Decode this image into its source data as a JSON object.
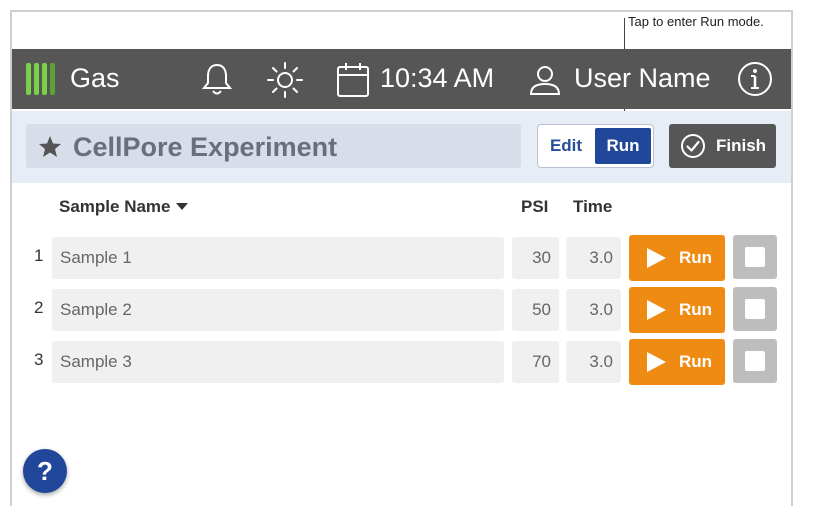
{
  "annotation": {
    "text": "Tap to enter Run mode."
  },
  "topbar": {
    "gas_label": "Gas",
    "time": "10:34 AM",
    "user_name": "User Name",
    "icons": [
      "gas-bars-icon",
      "bell-icon",
      "sun-icon",
      "calendar-icon",
      "user-icon",
      "info-icon"
    ]
  },
  "experiment": {
    "title": "CellPore Experiment",
    "edit_label": "Edit",
    "run_label": "Run",
    "finish_label": "Finish",
    "mode": "Run"
  },
  "table": {
    "headers": {
      "name": "Sample Name",
      "psi": "PSI",
      "time": "Time"
    },
    "rows": [
      {
        "num": "1",
        "name": "Sample 1",
        "psi": "30",
        "time": "3.0",
        "run_label": "Run",
        "checked": false
      },
      {
        "num": "2",
        "name": "Sample 2",
        "psi": "50",
        "time": "3.0",
        "run_label": "Run",
        "checked": false
      },
      {
        "num": "3",
        "name": "Sample 3",
        "psi": "70",
        "time": "3.0",
        "run_label": "Run",
        "checked": false
      }
    ]
  },
  "help": {
    "label": "?"
  },
  "colors": {
    "topbar": "#565656",
    "accent_blue": "#20479a",
    "run_orange": "#ef8a12",
    "gas_green": "#7bd04a",
    "experiment_bar": "#e6edf6"
  }
}
